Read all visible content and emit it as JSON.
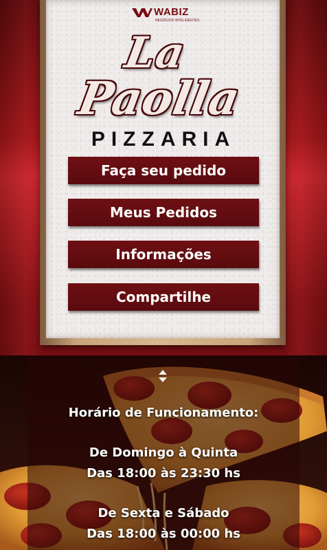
{
  "brand": {
    "name": "WABIZ",
    "tagline": "NEGÓCIOS INTELIGENTES"
  },
  "logo": {
    "line1": "La",
    "line2": "Paolla",
    "subtitle": "PIZZARIA"
  },
  "menu": {
    "items": [
      {
        "label": "Faça seu pedido"
      },
      {
        "label": "Meus Pedidos"
      },
      {
        "label": "Informações"
      },
      {
        "label": "Compartilhe"
      }
    ]
  },
  "hours": {
    "title": "Horário de Funcionamento:",
    "groups": [
      {
        "days": "De Domingo à Quinta",
        "time": "Das 18:00 às 23:30 hs"
      },
      {
        "days": "De Sexta e Sábado",
        "time": "Das 18:00 às 00:00 hs"
      }
    ]
  },
  "colors": {
    "primary": "#6e1014",
    "background": "#9b1519",
    "card": "#efeceb",
    "text_light": "#ffffff"
  },
  "icons": {
    "scroll": "scroll-arrows-icon"
  }
}
